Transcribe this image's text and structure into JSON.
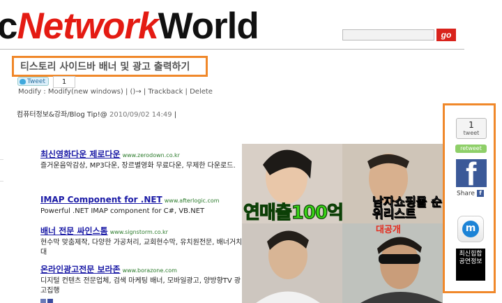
{
  "header": {
    "logo_prefix": "c",
    "logo_network": "Network",
    "logo_world": "World",
    "search_placeholder": "",
    "go_label": "go"
  },
  "post": {
    "title": "티스토리 사이드바 배너 및 광고 출력하기",
    "tweet_label": "Tweet",
    "tweet_count": "1",
    "actions": "Modify : Modify(new windows) | ()→ | Trackback | Delete",
    "category": "컴퓨터정보&강좌/Blog Tip!@",
    "date": "2010/09/02 14:49",
    "meta_sep": "|"
  },
  "ads": [
    {
      "title": "최신영화다운 제로다운",
      "url": "www.zerodown.co.kr",
      "desc": "즐거운음악감상, MP3다운, 장르별영화 무료다운, 무제한 다운로드."
    },
    {
      "title": "IMAP Component for .NET",
      "url": "www.afterlogic.com",
      "desc": "Powerful .NET IMAP component for C#, VB.NET"
    },
    {
      "title": "배너 전문 싸인스톰",
      "url": "www.signstorm.co.kr",
      "desc": "현수막 맞춤제작, 다양한 가공처리, 교회현수막, 유치원전문, 배너거치대"
    },
    {
      "title": "온라인광고전문 보라존",
      "url": "www.borazone.com",
      "desc": "디지털 컨텐츠 전문업체, 검색 마케팅 배너, 모바일광고, 양방향TV 광고집행"
    }
  ],
  "banner": {
    "headline": "연매출100억",
    "side_text": "남자쇼핑몰 순위리스트",
    "red_text": "대공개"
  },
  "sidebar": {
    "tweet_count": "1",
    "tweet_label": "tweet",
    "retweet_label": "retweet",
    "fb_letter": "f",
    "share_label": "Share",
    "share_mini": "f",
    "m_letter": "m",
    "badge_text": "최신힙합 공연정보"
  },
  "colors": {
    "brand_red": "#e41b13",
    "highlight_orange": "#f0882a",
    "facebook_blue": "#3b5998",
    "retweet_green": "#8ecf68"
  }
}
